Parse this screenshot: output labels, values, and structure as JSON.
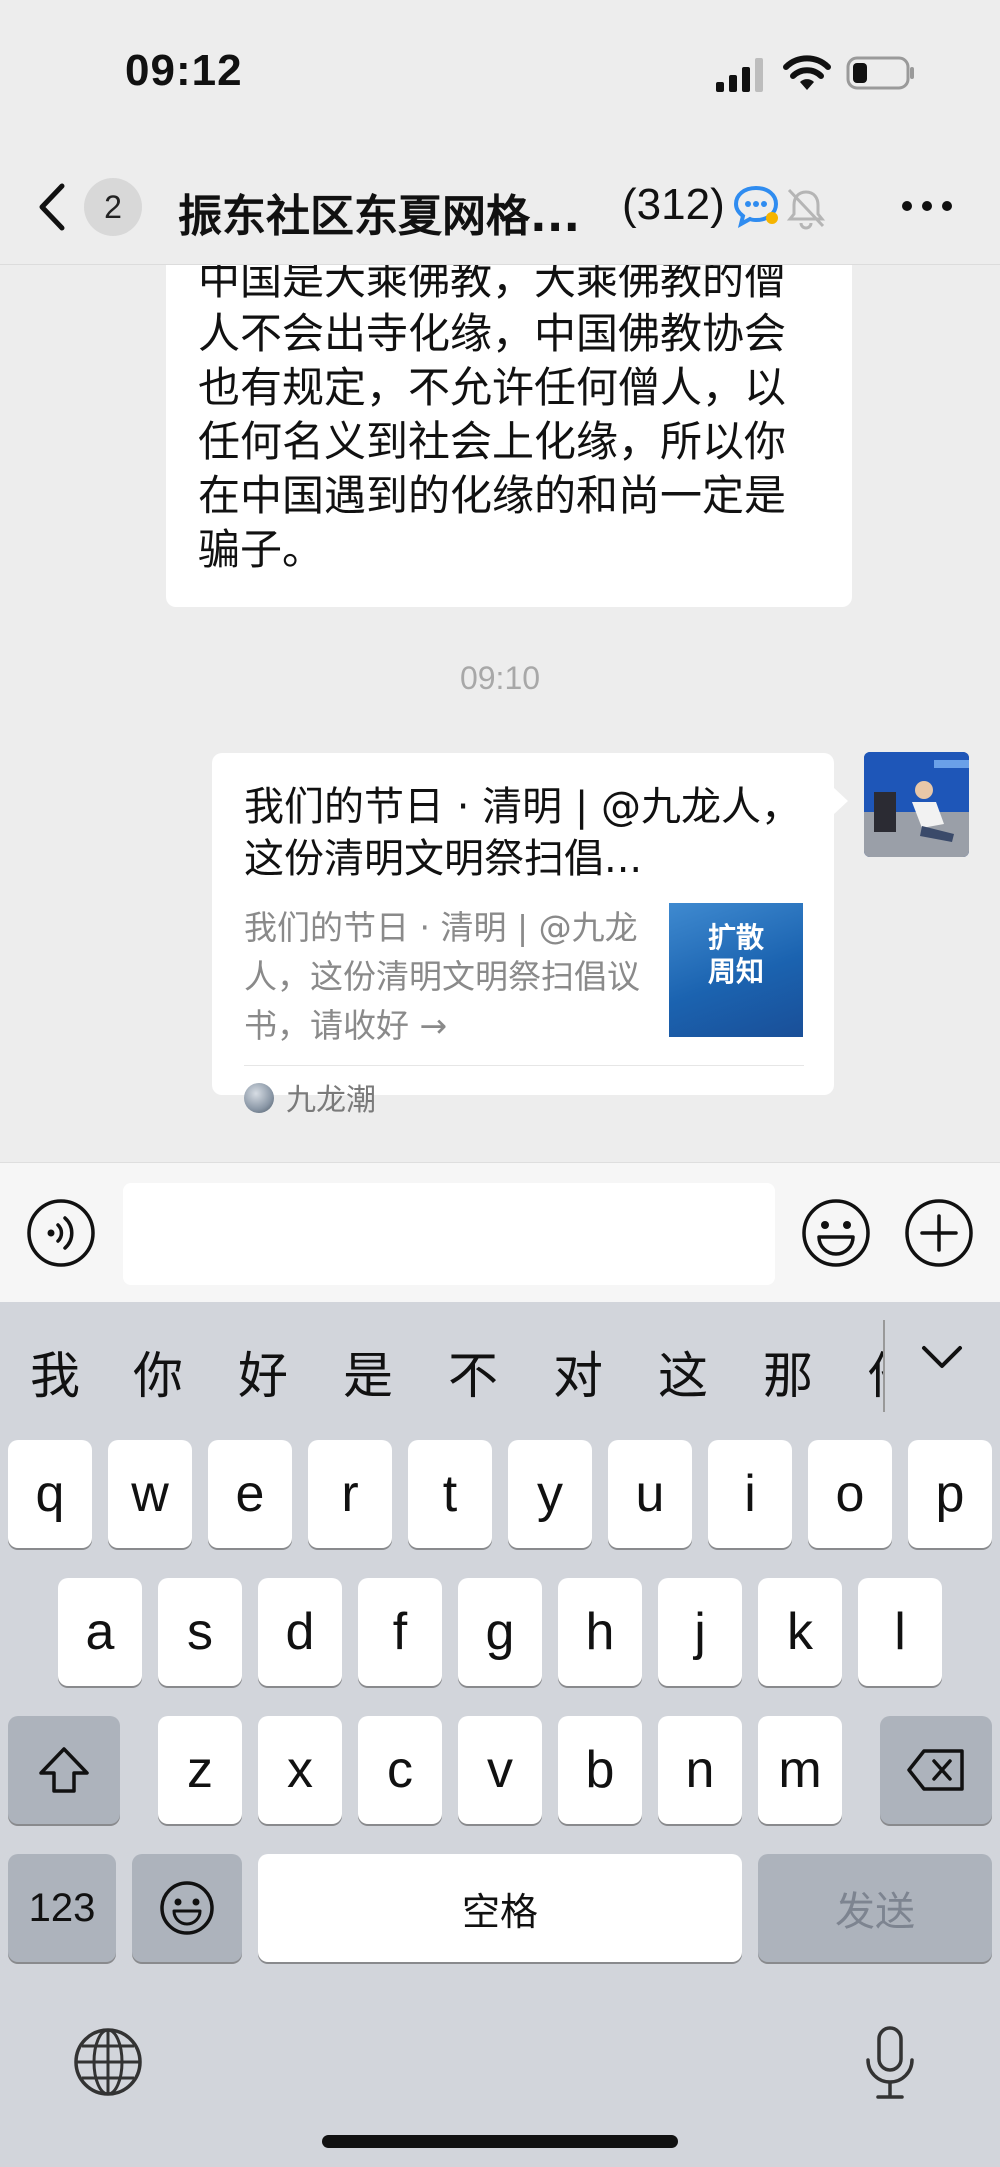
{
  "status_bar": {
    "time": "09:12"
  },
  "nav": {
    "unread_count": "2",
    "title": "振东社区东夏网格...",
    "member_count": "(312)"
  },
  "chat": {
    "text_message": "中国是大乘佛教，大乘佛教的僧人不会出寺化缘，中国佛教协会也有规定，不允许任何僧人，以任何名义到社会上化缘，所以你在中国遇到的化缘的和尚一定是骗子。",
    "timestamp": "09:10",
    "link_card": {
      "title": "我们的节日 · 清明 | @九龙人，这份清明文明祭扫倡...",
      "description": "我们的节日 · 清明 | @九龙人，这份清明文明祭扫倡议书，请收好 →",
      "thumbnail_text": "扩散\n周知",
      "source": "九龙潮"
    }
  },
  "input": {
    "value": "",
    "placeholder": ""
  },
  "keyboard": {
    "candidates": [
      "我",
      "你",
      "好",
      "是",
      "不",
      "对",
      "这",
      "那",
      "他"
    ],
    "row1": [
      "q",
      "w",
      "e",
      "r",
      "t",
      "y",
      "u",
      "i",
      "o",
      "p"
    ],
    "row2": [
      "a",
      "s",
      "d",
      "f",
      "g",
      "h",
      "j",
      "k",
      "l"
    ],
    "row3": [
      "z",
      "x",
      "c",
      "v",
      "b",
      "n",
      "m"
    ],
    "numbers_label": "123",
    "space_label": "空格",
    "send_label": "发送"
  },
  "icons": {
    "back": "chevron-left-icon",
    "chat_mode": "chat-bubble-icon",
    "mute": "bell-slash-icon",
    "more": "more-icon",
    "voice": "voice-icon",
    "emoji": "emoji-icon",
    "plus": "plus-icon",
    "shift": "shift-icon",
    "delete": "backspace-icon",
    "globe": "globe-icon",
    "mic": "microphone-icon"
  },
  "colors": {
    "background": "#ededed",
    "bubble": "#ffffff",
    "keyboard": "#d2d5db",
    "link_blue": "#1b63b0"
  }
}
